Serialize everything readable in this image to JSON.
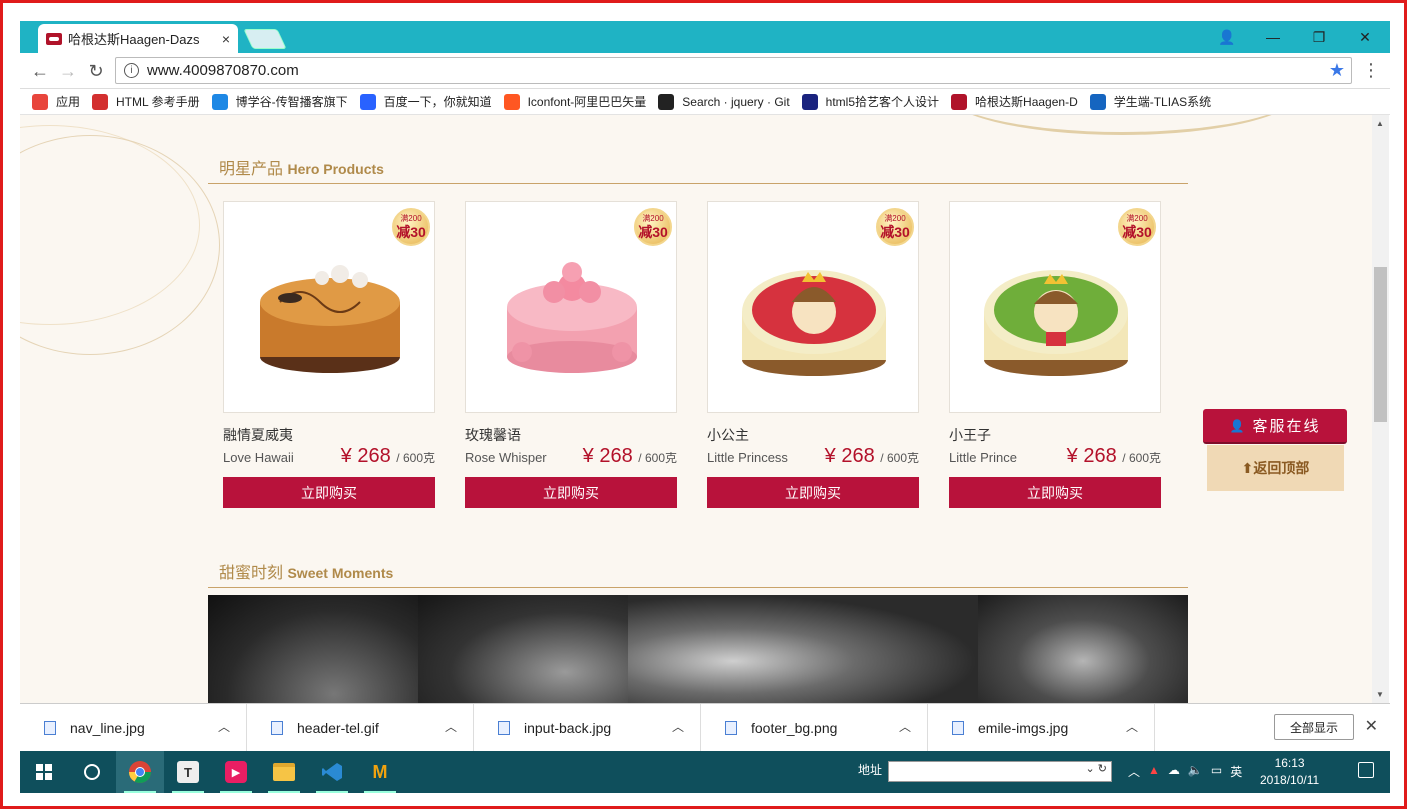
{
  "browser": {
    "tab_title": "哈根达斯Haagen-Dazs",
    "tab_close": "×",
    "url": "www.4009870870.com",
    "win_controls": {
      "account": "👤",
      "minimize": "—",
      "restore": "❐",
      "close": "✕"
    }
  },
  "bookmarks": [
    {
      "label": "应用",
      "color": "#e8453c"
    },
    {
      "label": "HTML 参考手册",
      "color": "#d32f2f"
    },
    {
      "label": "博学谷-传智播客旗下",
      "color": "#1e88e5"
    },
    {
      "label": "百度一下，你就知道",
      "color": "#2962ff"
    },
    {
      "label": "Iconfont-阿里巴巴矢量",
      "color": "#ff5722"
    },
    {
      "label": "Search · jquery · Git",
      "color": "#222222"
    },
    {
      "label": "html5拾艺客个人设计",
      "color": "#1a237e"
    },
    {
      "label": "哈根达斯Haagen-D",
      "color": "#b0132a"
    },
    {
      "label": "学生端-TLIAS系统",
      "color": "#1565c0"
    }
  ],
  "hero": {
    "title_cn": "明星产品",
    "title_en": "Hero Products"
  },
  "products": [
    {
      "name": "融情夏威夷",
      "en": "Love Hawaii",
      "price": "¥ 268",
      "unit": "/ 600克",
      "buy": "立即购买",
      "badge_small": "满200",
      "badge_big": "减30",
      "cake": "caramel"
    },
    {
      "name": "玫瑰馨语",
      "en": "Rose Whisper",
      "price": "¥ 268",
      "unit": "/ 600克",
      "buy": "立即购买",
      "badge_small": "满200",
      "badge_big": "减30",
      "cake": "rose"
    },
    {
      "name": "小公主",
      "en": "Little Princess",
      "price": "¥ 268",
      "unit": "/ 600克",
      "buy": "立即购买",
      "badge_small": "满200",
      "badge_big": "减30",
      "cake": "princess"
    },
    {
      "name": "小王子",
      "en": "Little Prince",
      "price": "¥ 268",
      "unit": "/ 600克",
      "buy": "立即购买",
      "badge_small": "满200",
      "badge_big": "减30",
      "cake": "prince"
    }
  ],
  "sweet": {
    "title_cn": "甜蜜时刻",
    "title_en": "Sweet Moments"
  },
  "floating": {
    "kefu": "客服在线",
    "totop": "返回顶部"
  },
  "downloads": {
    "files": [
      "nav_line.jpg",
      "header-tel.gif",
      "input-back.jpg",
      "footer_bg.png",
      "emile-imgs.jpg"
    ],
    "show_all": "全部显示",
    "close": "✕"
  },
  "taskbar": {
    "address_label": "地址",
    "ime": "英",
    "time": "16:13",
    "date": "2018/10/11"
  }
}
